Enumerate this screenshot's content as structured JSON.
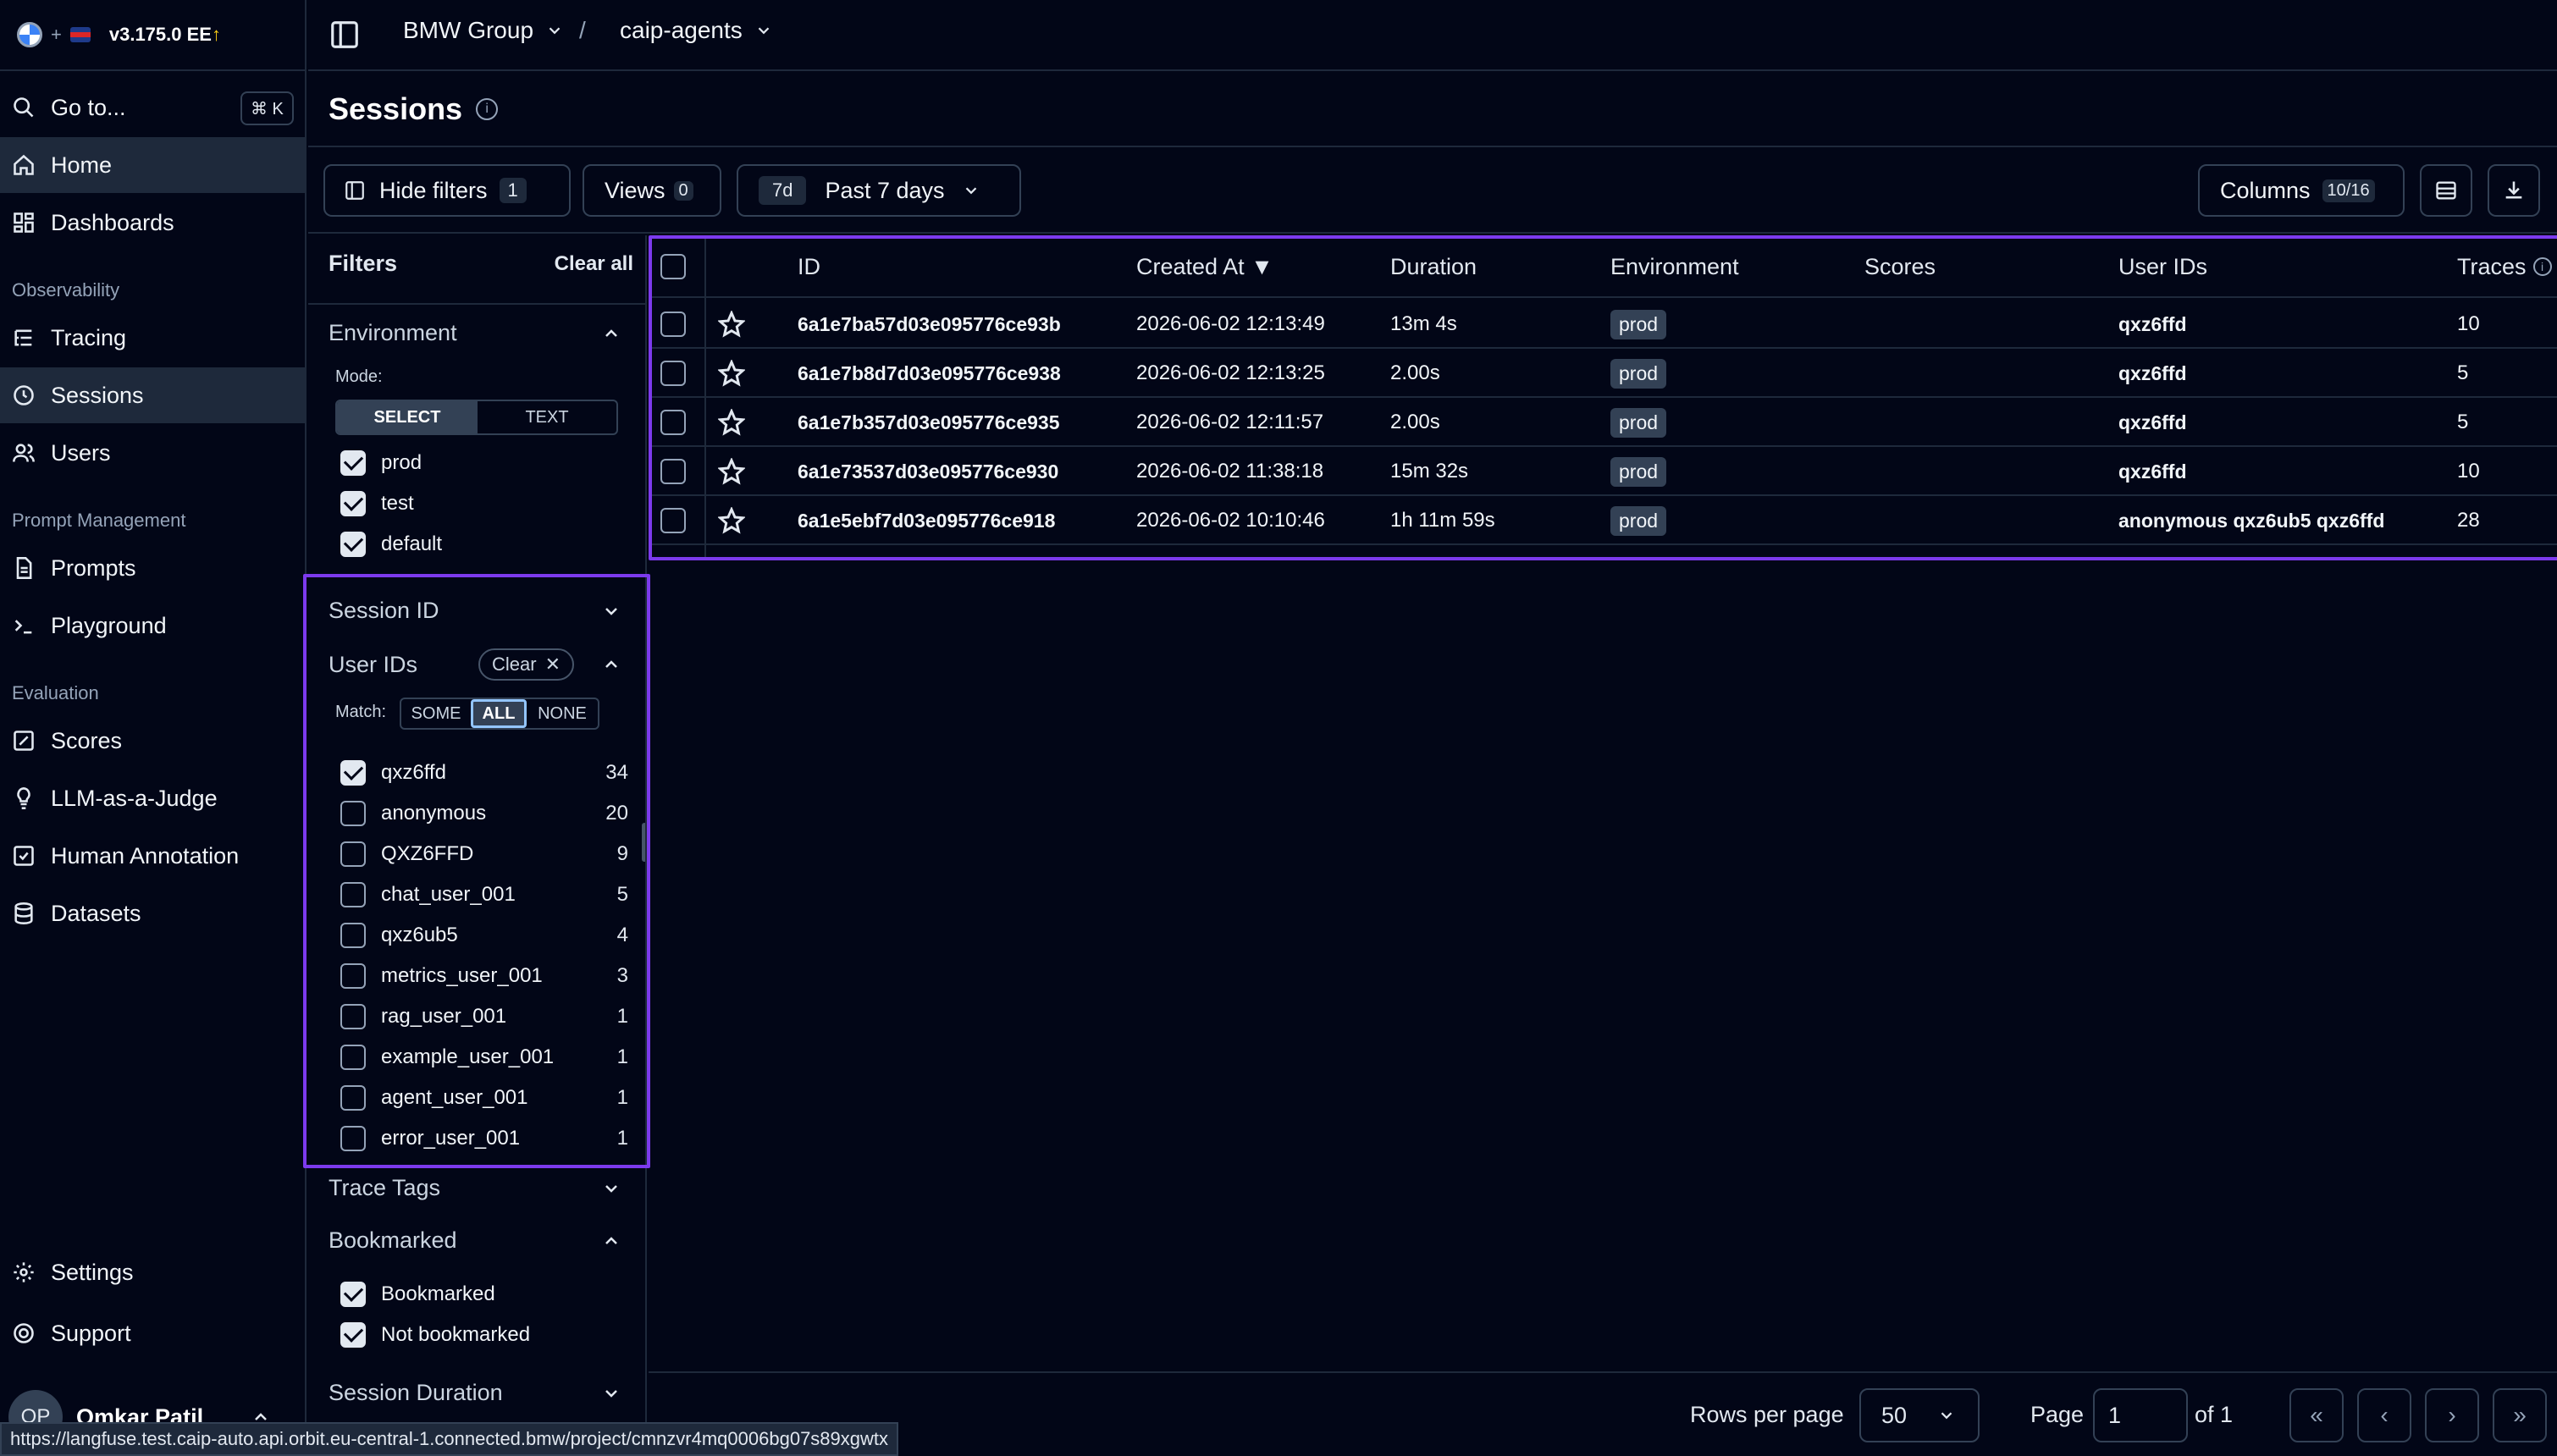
{
  "app": {
    "version": "v3.175.0 EE",
    "org": "BMW Group",
    "project": "caip-agents",
    "plus": "+"
  },
  "nav": {
    "goto": "Go to...",
    "goto_kbd": "⌘ K",
    "home": "Home",
    "dashboards": "Dashboards",
    "obs": "Observability",
    "tracing": "Tracing",
    "sessions": "Sessions",
    "users": "Users",
    "pm": "Prompt Management",
    "prompts": "Prompts",
    "playground": "Playground",
    "eval": "Evaluation",
    "scores": "Scores",
    "llm": "LLM-as-a-Judge",
    "human": "Human Annotation",
    "datasets": "Datasets",
    "settings": "Settings",
    "support": "Support"
  },
  "user": {
    "initials": "OP",
    "name": "Omkar Patil"
  },
  "page": {
    "title": "Sessions"
  },
  "toolbar": {
    "hide_filters": "Hide filters",
    "hide_filters_count": "1",
    "views": "Views",
    "views_count": "0",
    "range_short": "7d",
    "range_label": "Past 7 days",
    "columns": "Columns",
    "columns_count": "10/16"
  },
  "filters": {
    "title": "Filters",
    "clear_all": "Clear all",
    "environment": "Environment",
    "mode": "Mode:",
    "select": "SELECT",
    "text": "TEXT",
    "env_options": [
      "prod",
      "test",
      "default"
    ],
    "session_id": "Session ID",
    "user_ids": "User IDs",
    "clear": "Clear",
    "match": "Match:",
    "some": "SOME",
    "all": "ALL",
    "none": "NONE",
    "user_options": [
      {
        "label": "qxz6ffd",
        "count": "34",
        "checked": true
      },
      {
        "label": "anonymous",
        "count": "20",
        "checked": false
      },
      {
        "label": "QXZ6FFD",
        "count": "9",
        "checked": false
      },
      {
        "label": "chat_user_001",
        "count": "5",
        "checked": false
      },
      {
        "label": "qxz6ub5",
        "count": "4",
        "checked": false
      },
      {
        "label": "metrics_user_001",
        "count": "3",
        "checked": false
      },
      {
        "label": "rag_user_001",
        "count": "1",
        "checked": false
      },
      {
        "label": "example_user_001",
        "count": "1",
        "checked": false
      },
      {
        "label": "agent_user_001",
        "count": "1",
        "checked": false
      },
      {
        "label": "error_user_001",
        "count": "1",
        "checked": false
      }
    ],
    "trace_tags": "Trace Tags",
    "bookmarked": "Bookmarked",
    "bm_options": [
      "Bookmarked",
      "Not bookmarked"
    ],
    "session_duration": "Session Duration"
  },
  "table": {
    "headers": {
      "id": "ID",
      "created": "Created At ▼",
      "duration": "Duration",
      "env": "Environment",
      "scores": "Scores",
      "userids": "User IDs",
      "traces": "Traces"
    },
    "rows": [
      {
        "id": "6a1e7ba57d03e095776ce93b",
        "created": "2026-06-02 12:13:49",
        "duration": "13m 4s",
        "env": "prod",
        "users": "qxz6ffd",
        "traces": "10"
      },
      {
        "id": "6a1e7b8d7d03e095776ce938",
        "created": "2026-06-02 12:13:25",
        "duration": "2.00s",
        "env": "prod",
        "users": "qxz6ffd",
        "traces": "5"
      },
      {
        "id": "6a1e7b357d03e095776ce935",
        "created": "2026-06-02 12:11:57",
        "duration": "2.00s",
        "env": "prod",
        "users": "qxz6ffd",
        "traces": "5"
      },
      {
        "id": "6a1e73537d03e095776ce930",
        "created": "2026-06-02 11:38:18",
        "duration": "15m 32s",
        "env": "prod",
        "users": "qxz6ffd",
        "traces": "10"
      },
      {
        "id": "6a1e5ebf7d03e095776ce918",
        "created": "2026-06-02 10:10:46",
        "duration": "1h 11m 59s",
        "env": "prod",
        "users": "anonymous qxz6ub5 qxz6ffd",
        "traces": "28"
      }
    ]
  },
  "pager": {
    "rows_per_page": "Rows per page",
    "rows_value": "50",
    "page": "Page",
    "page_value": "1",
    "of": "of 1"
  },
  "status_url": "https://langfuse.test.caip-auto.api.orbit.eu-central-1.connected.bmw/project/cmnzvr4mq0006bg07s89xgwtx"
}
